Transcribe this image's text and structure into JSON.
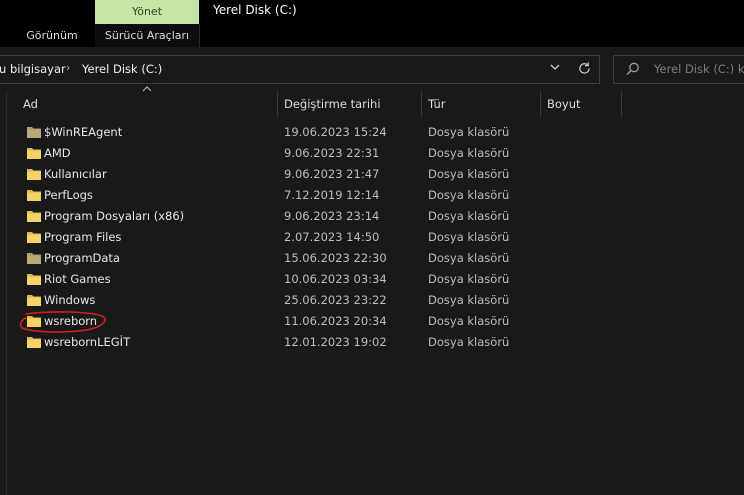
{
  "ribbon": {
    "manage_tab": "Yönet",
    "window_title": "Yerel Disk (C:)",
    "tabs": [
      "Görünüm",
      "Sürücü Araçları"
    ]
  },
  "address": {
    "crumbs": [
      "u bilgisayar",
      "Yerel Disk (C:)"
    ],
    "search_placeholder": "Yerel Disk (C:) kla"
  },
  "columns": {
    "name": "Ad",
    "modified": "Değiştirme tarihi",
    "type": "Tür",
    "size": "Boyut"
  },
  "files": [
    {
      "name": "$WinREAgent",
      "modified": "19.06.2023 15:24",
      "type": "Dosya klasörü",
      "hidden": true
    },
    {
      "name": "AMD",
      "modified": "9.06.2023 22:31",
      "type": "Dosya klasörü",
      "hidden": false
    },
    {
      "name": "Kullanıcılar",
      "modified": "9.06.2023 21:47",
      "type": "Dosya klasörü",
      "hidden": false
    },
    {
      "name": "PerfLogs",
      "modified": "7.12.2019 12:14",
      "type": "Dosya klasörü",
      "hidden": false
    },
    {
      "name": "Program Dosyaları (x86)",
      "modified": "9.06.2023 23:14",
      "type": "Dosya klasörü",
      "hidden": false
    },
    {
      "name": "Program Files",
      "modified": "2.07.2023 14:50",
      "type": "Dosya klasörü",
      "hidden": false
    },
    {
      "name": "ProgramData",
      "modified": "15.06.2023 22:30",
      "type": "Dosya klasörü",
      "hidden": true
    },
    {
      "name": "Riot Games",
      "modified": "10.06.2023 03:34",
      "type": "Dosya klasörü",
      "hidden": false
    },
    {
      "name": "Windows",
      "modified": "25.06.2023 23:22",
      "type": "Dosya klasörü",
      "hidden": false
    },
    {
      "name": "wsreborn",
      "modified": "11.06.2023 20:34",
      "type": "Dosya klasörü",
      "hidden": false,
      "annotated": true
    },
    {
      "name": "wsrebornLEGİT",
      "modified": "12.01.2023 19:02",
      "type": "Dosya klasörü",
      "hidden": false
    }
  ],
  "colors": {
    "manage_accent": "#c5e6a6",
    "folder": "#f3d36a",
    "folder_hidden": "#a89a6a",
    "annotation": "#d0201a"
  }
}
